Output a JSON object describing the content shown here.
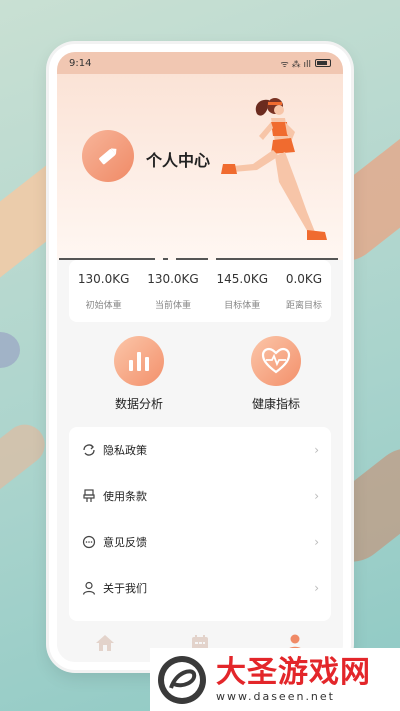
{
  "status_bar": {
    "time": "9:14",
    "signal": "ᯤ ⁂ ıll"
  },
  "header": {
    "title": "个人中心"
  },
  "stats": [
    {
      "value": "130.0KG",
      "label": "初始体重"
    },
    {
      "value": "130.0KG",
      "label": "当前体重"
    },
    {
      "value": "145.0KG",
      "label": "目标体重"
    },
    {
      "value": "0.0KG",
      "label": "距离目标"
    }
  ],
  "features": {
    "data_analysis": "数据分析",
    "health_index": "健康指标"
  },
  "menu": [
    {
      "label": "隐私政策",
      "icon": "refresh-icon"
    },
    {
      "label": "使用条款",
      "icon": "terms-icon"
    },
    {
      "label": "意见反馈",
      "icon": "feedback-icon"
    },
    {
      "label": "关于我们",
      "icon": "user-icon"
    }
  ],
  "chevron": "›",
  "tabbar": [
    {
      "icon": "home-icon",
      "active": false
    },
    {
      "icon": "calendar-icon",
      "active": false
    },
    {
      "icon": "person-icon",
      "active": true
    }
  ],
  "watermark": {
    "brand": "大圣游戏网",
    "url": "www.daseen.net"
  },
  "colors": {
    "accent": "#f08a66",
    "active_tab": "#f08a66",
    "inactive_tab": "#e3d3cb"
  }
}
